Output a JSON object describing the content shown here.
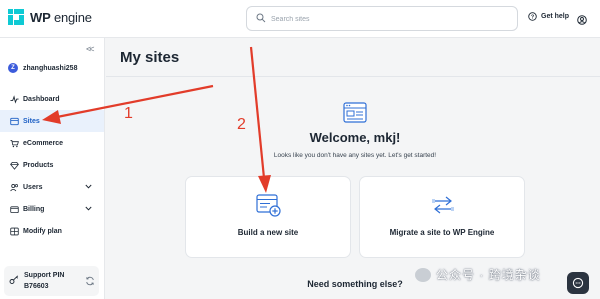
{
  "header": {
    "logo_text_bold": "WP",
    "logo_text": "engine",
    "search_placeholder": "Search sites",
    "help_label": "Get help"
  },
  "sidebar": {
    "collapse_glyph": "<<",
    "account": {
      "initial": "Z",
      "name": "zhanghuashi258"
    },
    "items": [
      {
        "label": "Dashboard",
        "icon": "activity-icon"
      },
      {
        "label": "Sites",
        "icon": "sites-icon",
        "active": true
      },
      {
        "label": "eCommerce",
        "icon": "cart-icon"
      },
      {
        "label": "Products",
        "icon": "gem-icon"
      },
      {
        "label": "Users",
        "icon": "users-icon",
        "expandable": true
      },
      {
        "label": "Billing",
        "icon": "wallet-icon",
        "expandable": true
      },
      {
        "label": "Modify plan",
        "icon": "modify-icon"
      }
    ],
    "support": {
      "title": "Support PIN",
      "pin": "B76603"
    }
  },
  "main": {
    "title": "My sites",
    "welcome_title": "Welcome, mkj!",
    "welcome_sub": "Looks like you don't have any sites yet. Let's get started!",
    "cards": [
      {
        "label": "Build a new site",
        "icon": "site-add-icon"
      },
      {
        "label": "Migrate a site to WP Engine",
        "icon": "migrate-arrows-icon"
      }
    ],
    "need_more": "Need something else?"
  },
  "annotations": {
    "step1": "1",
    "step2": "2",
    "arrow_color": "#e23c2a"
  },
  "watermark": "公众号 · 跨境杂谈",
  "colors": {
    "accent": "#1c5fc4",
    "brand": "#0ecad4",
    "active_bg": "#e9f1fc"
  }
}
